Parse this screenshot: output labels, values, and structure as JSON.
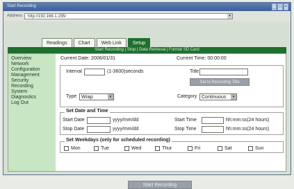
{
  "window": {
    "title": "Start Recording"
  },
  "address": {
    "label": "Address",
    "value": "http://192.168.1.155/"
  },
  "tabs": [
    {
      "label": "Readings",
      "active": false
    },
    {
      "label": "Chart",
      "active": false
    },
    {
      "label": "Web Link",
      "active": false
    },
    {
      "label": "Setup",
      "active": true
    }
  ],
  "subnav": "Start Recording | Stop | Data Retrieval | Format SD Card",
  "sidebar": {
    "items": [
      "Overview",
      "Network",
      "Configuration",
      "Management",
      "Security",
      "Recording",
      "System",
      "Diagnostics",
      "Log Out"
    ]
  },
  "status": {
    "current_date": "Current Date: 2006/01/31",
    "current_time": "Current Time: 00:00:00"
  },
  "recording": {
    "interval_label": "Interval",
    "interval_hint": "(1-3600)seconds",
    "title_label": "Title",
    "title_button": "Set to Recording Title",
    "type_label": "Type",
    "type_value": "Wrap",
    "category_label": "Category",
    "category_value": "Continuous"
  },
  "date_time": {
    "legend": "Set Date and Time",
    "start_date": "Start Date",
    "stop_date": "Stop Date",
    "date_format": "yyyy/mm/dd",
    "start_time": "Start Time",
    "stop_time": "Stop Time",
    "time_format": "hh:mm:ss(24 hours)"
  },
  "weekdays": {
    "legend": "Set Weekdays (only for scheduled recording)",
    "days": [
      "Mon",
      "Tue",
      "Wed",
      "Thur",
      "Fri",
      "Sat",
      "Sun"
    ]
  },
  "buttons": {
    "start": "Start Recording"
  }
}
